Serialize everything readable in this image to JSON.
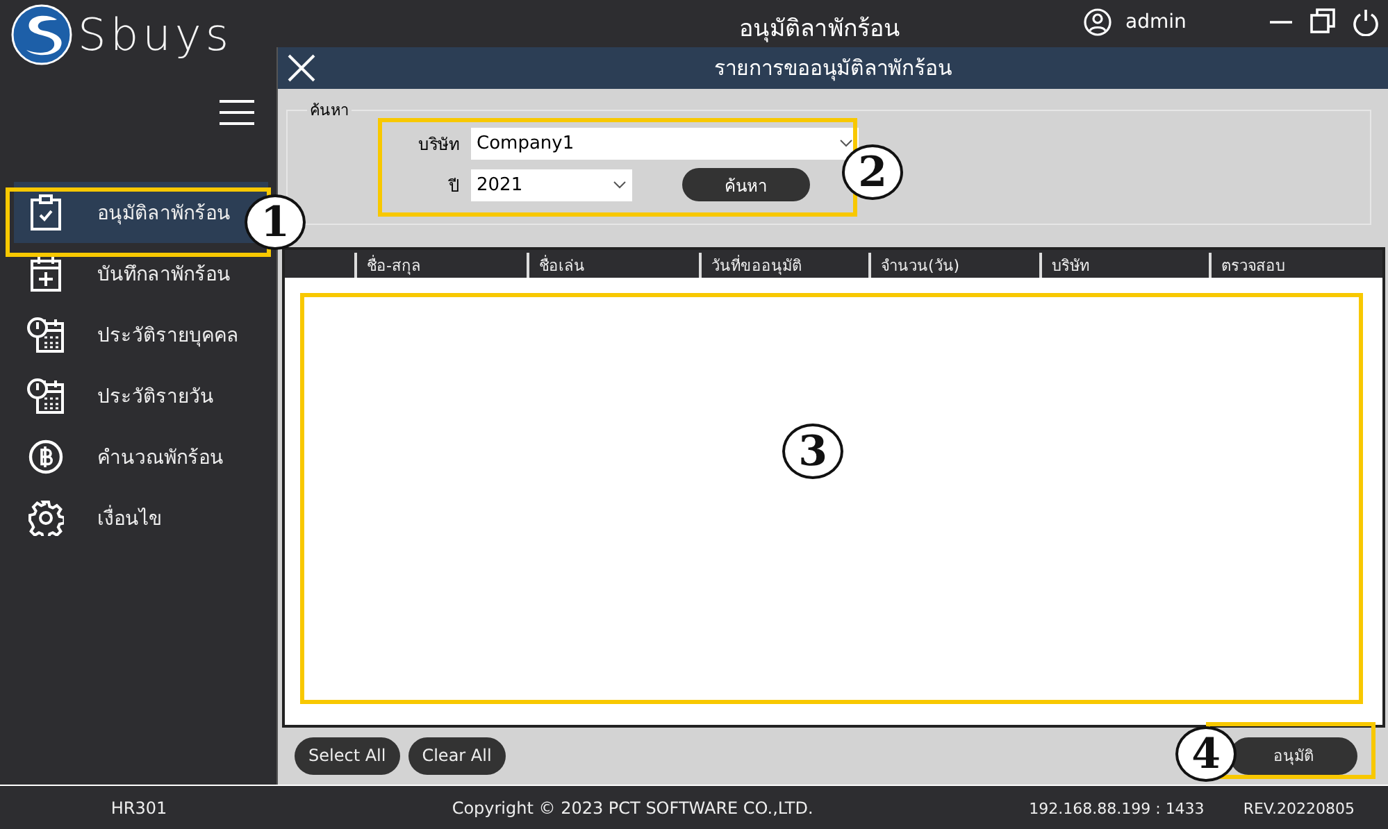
{
  "app": {
    "logo": "Sbuys",
    "title": "อนุมัติลาพักร้อน",
    "user": "admin"
  },
  "sidebar": {
    "items": [
      {
        "label": "อนุมัติลาพักร้อน",
        "kind": "approve",
        "selected": true
      },
      {
        "label": "บันทึกลาพักร้อน",
        "kind": "record",
        "selected": false
      },
      {
        "label": "ประวัติรายบุคคล",
        "kind": "history",
        "selected": false
      },
      {
        "label": "ประวัติรายวัน",
        "kind": "history",
        "selected": false
      },
      {
        "label": "คำนวณพักร้อน",
        "kind": "calculate",
        "selected": false
      },
      {
        "label": "เงื่อนไข",
        "kind": "settings",
        "selected": false
      }
    ]
  },
  "panel": {
    "title": "รายการขออนุมัติลาพักร้อน",
    "search": {
      "legend": "ค้นหา",
      "company_label": "บริษัท",
      "company": "Company1",
      "year_label": "ปี",
      "year": "2021",
      "button": "ค้นหา"
    },
    "table": {
      "columns": [
        "ชื่อ-สกุล",
        "ชื่อเล่น",
        "วันที่ขออนุมัติ",
        "จำนวน(วัน)",
        "บริษัท",
        "ตรวจสอบ"
      ]
    },
    "buttons": [
      "Select All",
      "Clear All"
    ],
    "approve": "อนุมัติ"
  },
  "callouts": [
    {
      "number": "1"
    },
    {
      "number": "2"
    },
    {
      "number": "3"
    },
    {
      "number": "4"
    }
  ],
  "status_bar": {
    "code": "HR301",
    "copyright": "Copyright © 2023 PCT SOFTWARE CO.,LTD.",
    "server": "192.168.88.199 : 1433",
    "revision": "REV.20220805"
  }
}
